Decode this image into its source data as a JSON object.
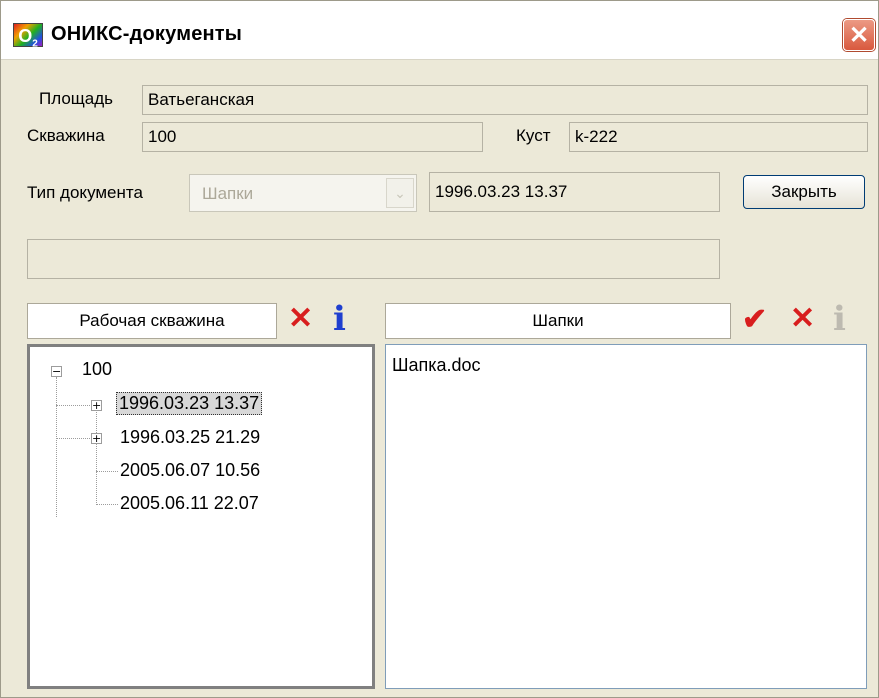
{
  "window": {
    "logo_text": "O",
    "logo_sub": "2",
    "title": "ОНИКС-документы",
    "close_glyph": "✕"
  },
  "form": {
    "area_label": "Площадь",
    "area_value": "Ватьеганская",
    "well_label": "Скважина",
    "well_value": "100",
    "cluster_label": "Куст",
    "cluster_value": "k-222",
    "doctype_label": "Тип документа",
    "doctype_selected": "Шапки",
    "doctype_arrow": "⌄",
    "date_value": "1996.03.23 13.37",
    "close_button": "Закрыть",
    "status_value": ""
  },
  "left_panel": {
    "header": "Рабочая скважина",
    "delete_icon": "✕",
    "info_icon": "i",
    "tree": {
      "root": "100",
      "root_toggle": "−",
      "child_toggle": "+",
      "items": [
        "1996.03.23 13.37",
        "1996.03.25 21.29",
        "2005.06.07 10.56",
        "2005.06.11 22.07"
      ]
    }
  },
  "right_panel": {
    "header": "Шапки",
    "check_icon": "✔",
    "delete_icon": "✕",
    "info_icon": "i",
    "files": [
      "Шапка.doc"
    ]
  }
}
